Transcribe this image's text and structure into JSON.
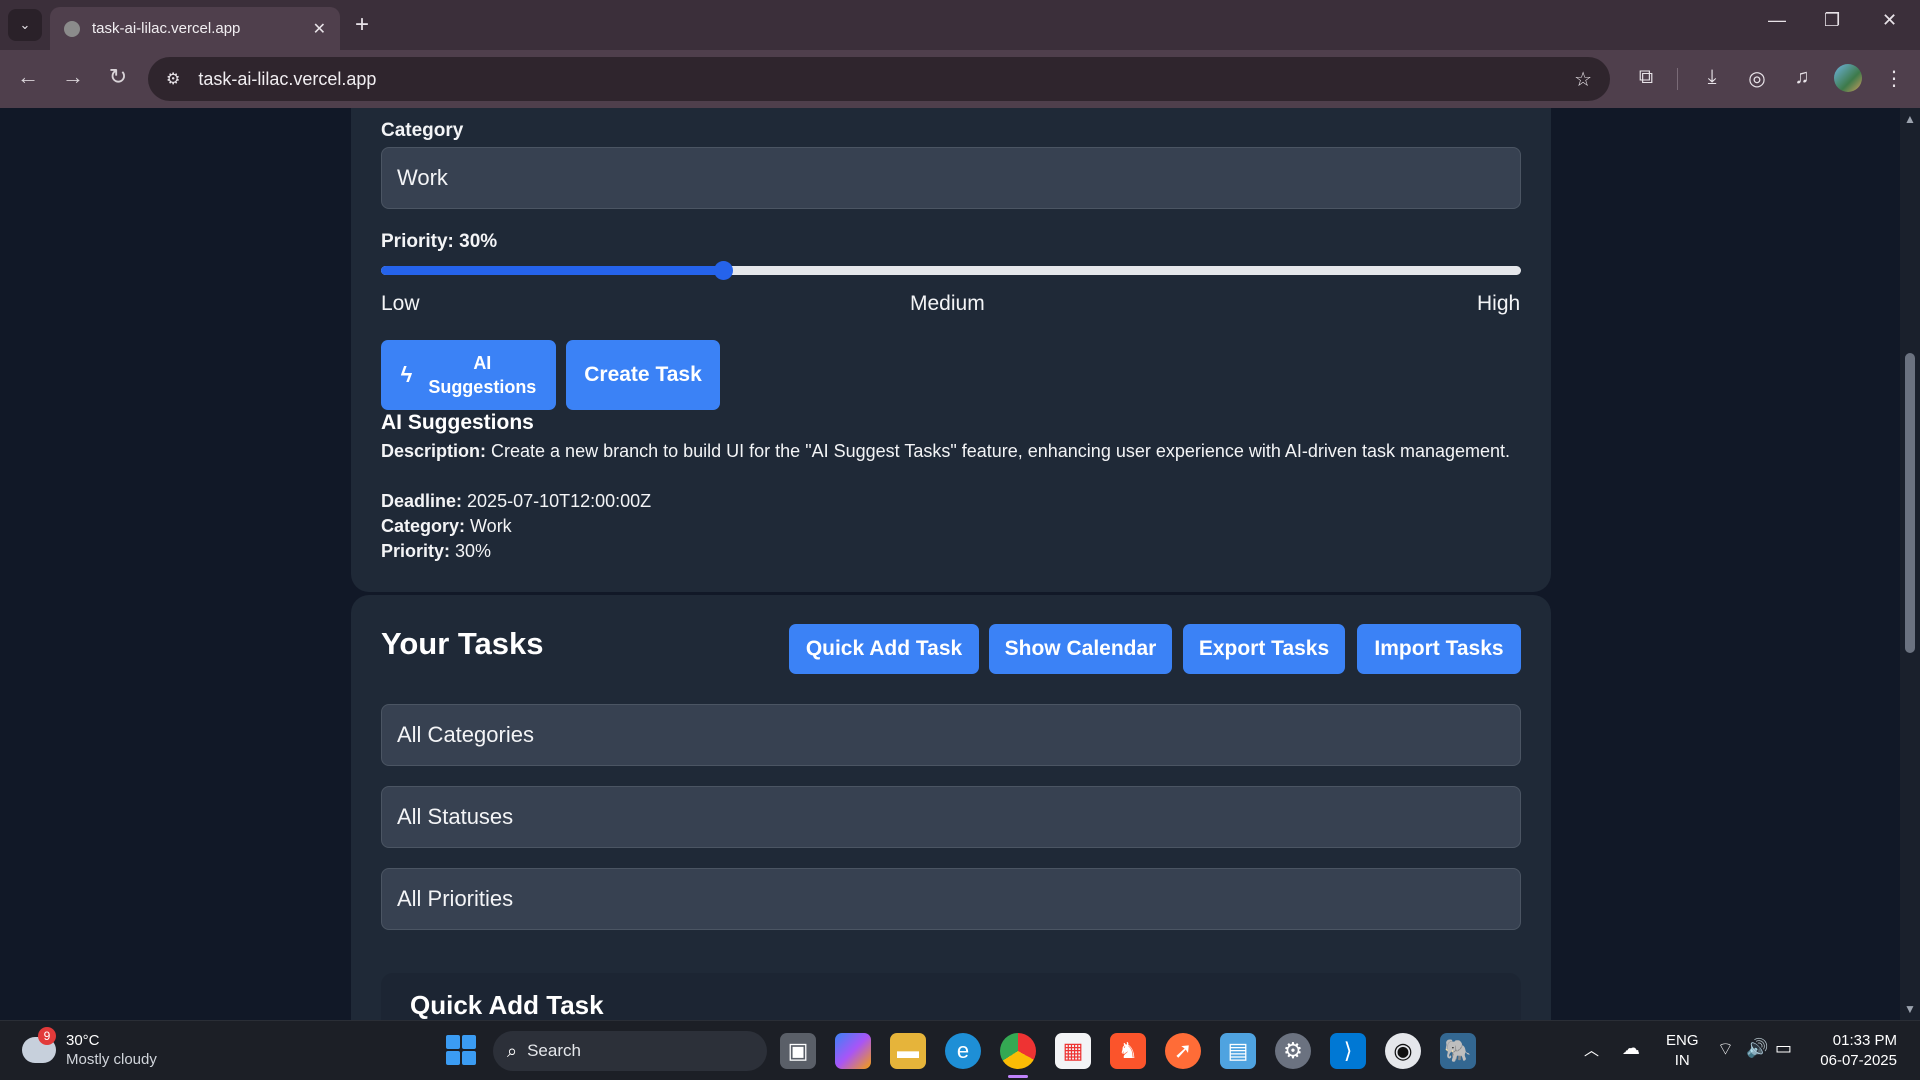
{
  "browser": {
    "tab_title": "task-ai-lilac.vercel.app",
    "url": "task-ai-lilac.vercel.app"
  },
  "form": {
    "category_label": "Category",
    "category_value": "Work",
    "priority_label": "Priority: 30%",
    "priority_value": 0.3,
    "priority_low": "Low",
    "priority_medium": "Medium",
    "priority_high": "High",
    "ai_button_label_1": "AI",
    "ai_button_label_2": "Suggestions",
    "create_button_label": "Create Task"
  },
  "suggestions": {
    "title": "AI Suggestions",
    "description_key": "Description:",
    "description_val": " Create a new branch to build UI for the \"AI Suggest Tasks\" feature, enhancing user experience with AI-driven task management.",
    "deadline_key": "Deadline:",
    "deadline_val": " 2025-07-10T12:00:00Z",
    "category_key": "Category:",
    "category_val": " Work",
    "priority_key": "Priority:",
    "priority_val": " 30%"
  },
  "tasks": {
    "title": "Your Tasks",
    "quick_add": "Quick Add Task",
    "show_calendar": "Show Calendar",
    "export": "Export Tasks",
    "import": "Import Tasks",
    "filter_categories": "All Categories",
    "filter_statuses": "All Statuses",
    "filter_priorities": "All Priorities",
    "quick_add_heading": "Quick Add Task"
  },
  "taskbar": {
    "weather_temp": "30°C",
    "weather_desc": "Mostly cloudy",
    "weather_badge": "9",
    "search_label": "Search",
    "lang_1": "ENG",
    "lang_2": "IN",
    "time": "01:33 PM",
    "date": "06-07-2025"
  },
  "colors": {
    "accent": "#3b82f6",
    "card_bg": "#1f2937",
    "page_bg": "#111827"
  }
}
